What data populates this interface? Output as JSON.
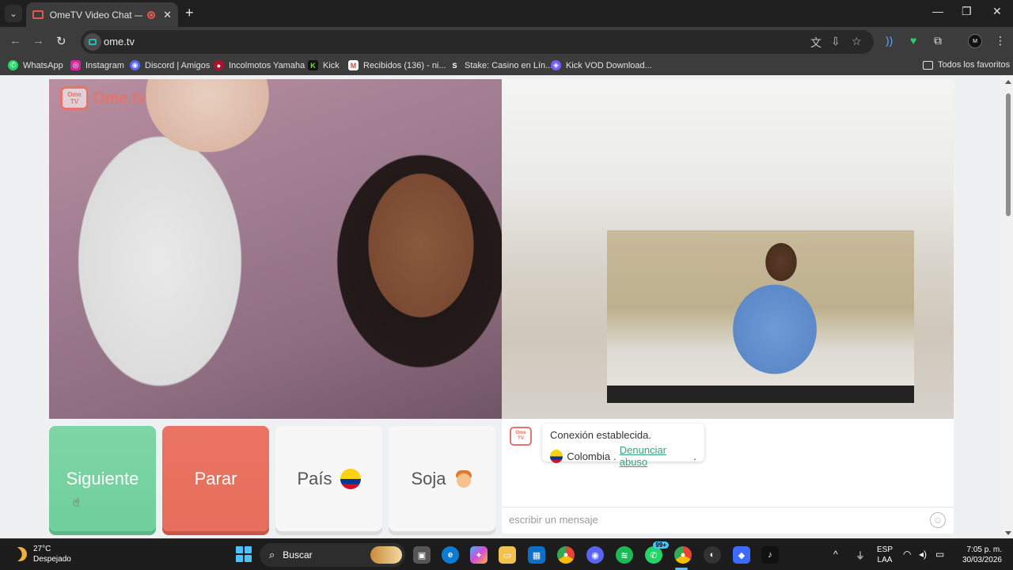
{
  "browser": {
    "tab_title": "OmeTV Video Chat — Alter",
    "tab_close": "✕",
    "new_tab": "+",
    "url": "ome.tv",
    "window_controls": {
      "minimize": "—",
      "maximize": "❐",
      "close": "✕"
    }
  },
  "bookmarks": {
    "items": [
      {
        "label": "WhatsApp",
        "icon": "whatsapp-icon",
        "color": "#25d366",
        "glyph": "✆"
      },
      {
        "label": "Instagram",
        "icon": "instagram-icon",
        "color": "#d6249f",
        "glyph": "◎"
      },
      {
        "label": "Discord | Amigos",
        "icon": "discord-icon",
        "color": "#5865f2",
        "glyph": "◉"
      },
      {
        "label": "Incolmotos Yamaha",
        "icon": "yamaha-icon",
        "color": "#b0102a",
        "glyph": "●"
      },
      {
        "label": "Kick",
        "icon": "kick-icon",
        "color": "#111111",
        "glyph": "K"
      },
      {
        "label": "Recibidos (136) - ni...",
        "icon": "gmail-icon",
        "color": "#ea4335",
        "glyph": "M"
      },
      {
        "label": "Stake: Casino en Lín...",
        "icon": "stake-icon",
        "color": "#3c3c3c",
        "glyph": "S"
      },
      {
        "label": "Kick VOD Download...",
        "icon": "kickvod-icon",
        "color": "#7a5cff",
        "glyph": "◈"
      }
    ],
    "all_favorites": "Todos los favoritos"
  },
  "site": {
    "logo_tv_line1": "Ome",
    "logo_tv_line2": "TV",
    "logo_text": "Ome.tv"
  },
  "controls": {
    "next_label": "Siguiente",
    "stop_label": "Parar",
    "country_label": "País",
    "gender_label": "Soja"
  },
  "chat": {
    "status": "Conexión establecida.",
    "country": "Colombia",
    "separator": ".",
    "report_link": "Denunciar abuso",
    "report_suffix": ".",
    "placeholder": "escribir un mensaje",
    "emoji_glyph": "☺"
  },
  "taskbar": {
    "weather_temp": "27°C",
    "weather_desc": "Despejado",
    "search_label": "Buscar",
    "whatsapp_badge": "99+",
    "lang_line1": "ESP",
    "lang_line2": "LAA",
    "time": "7:05 p. m.",
    "date": "30/03/2026"
  },
  "colors": {
    "next_button": "#70cf9c",
    "stop_button": "#e66e5b",
    "brand": "#e5746a",
    "link": "#3aa07c"
  }
}
